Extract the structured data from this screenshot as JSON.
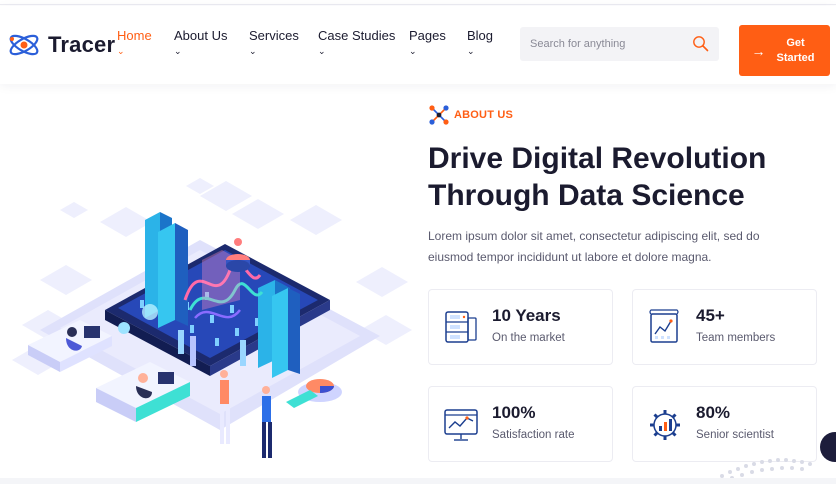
{
  "brand": {
    "name": "Tracer"
  },
  "nav": {
    "items": [
      {
        "label": "Home",
        "active": true
      },
      {
        "label": "About Us",
        "active": false
      },
      {
        "label": "Services",
        "active": false
      },
      {
        "label": "Case Studies",
        "active": false
      },
      {
        "label": "Pages",
        "active": false
      },
      {
        "label": "Blog",
        "active": false
      }
    ],
    "caret": "⌄"
  },
  "search": {
    "placeholder": "Search for anything",
    "icon": "search-icon"
  },
  "cta": {
    "label": "Get Started",
    "icon": "arrow-right-icon"
  },
  "hero": {
    "eyebrow": "ABOUT US",
    "title": "Drive Digital Revolution Through Data Science",
    "description": "Lorem ipsum dolor sit amet, consectetur adipiscing elit, sed do eiusmod tempor incididunt ut labore et dolore magna."
  },
  "stats": [
    {
      "value": "10 Years",
      "label": "On the market",
      "icon": "server-icon"
    },
    {
      "value": "45+",
      "label": "Team members",
      "icon": "chart-board-icon"
    },
    {
      "value": "100%",
      "label": "Satisfaction rate",
      "icon": "analytics-monitor-icon"
    },
    {
      "value": "80%",
      "label": "Senior scientist",
      "icon": "gear-chart-icon"
    }
  ],
  "colors": {
    "accent": "#ff5e14",
    "primary": "#1b1b2f",
    "brand_blue": "#2b5fd9"
  }
}
